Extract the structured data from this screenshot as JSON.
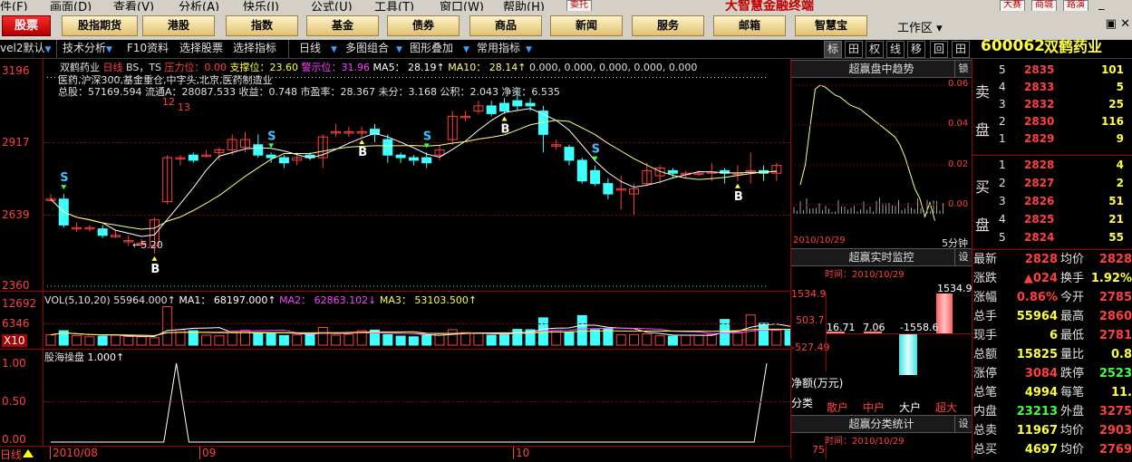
{
  "menu": {
    "items": [
      "件(F)",
      "画面(D)",
      "查看(V)",
      "分析(A)",
      "快乐(J)",
      "公式(U)",
      "工具(T)",
      "窗口(W)",
      "帮助(H)"
    ],
    "broker_btn": "委托",
    "brand": "大智慧金融终端",
    "right_btns": [
      "大赛",
      "商城",
      "路演"
    ]
  },
  "nav_buttons": [
    "股票",
    "股指期货",
    "港股",
    "指数",
    "基金",
    "债券",
    "商品",
    "新闻",
    "服务",
    "邮箱",
    "智慧宝"
  ],
  "workarea_label": "工作区",
  "toolbar": {
    "left_clip": "vel2默认",
    "items": [
      "技术分析",
      "F10资料",
      "选择股票",
      "选择指标",
      "日线",
      "多图组合",
      "图形叠加",
      "常用指标"
    ],
    "right_tabs": [
      "标",
      "田",
      "权",
      "线",
      "移",
      "回",
      "田"
    ]
  },
  "stock": {
    "code": "600062",
    "name": "双鹤药业"
  },
  "main_chart": {
    "legend_name": "双鹤药业",
    "legend_period": "日线",
    "legend_bs": "BS，TS",
    "pressure_label": "压力位：",
    "pressure_value": "0.00",
    "support_label": "支撑位：",
    "support_value": "23.60",
    "alert_label": "警示位：",
    "alert_value": "31.96",
    "ma5": "MA5： 28.19↑",
    "ma10": "MA10： 28.14↑",
    "extra": "0.000, 0.000, 0.000, 0.000, 0.000",
    "sectors": "医药,沪深300,基金重仓,中字头,北京,医药制造业",
    "info": "总股：57169.594 流通A：28087.533 收益：0.748 市盈率：28.367 未分：3.168 公积：2.043 净资：6.535",
    "y_ticks": [
      "3196",
      "2917",
      "2639",
      "2360"
    ],
    "annotation_low": "←5.20",
    "annotation_12": "12",
    "annotation_13": "13"
  },
  "chart_data": [
    {
      "type": "candlestick",
      "title": "双鹤药业 日线",
      "y_unit": "price x100",
      "ylim": [
        2360,
        3196
      ],
      "x_labels": [
        "2010/08",
        "09",
        "10"
      ],
      "candles": [
        {
          "o": 2700,
          "c": 2700,
          "h": 2720,
          "l": 2690
        },
        {
          "o": 2700,
          "c": 2600,
          "h": 2720,
          "l": 2590
        },
        {
          "o": 2590,
          "c": 2590,
          "h": 2610,
          "l": 2575
        },
        {
          "o": 2590,
          "c": 2590,
          "h": 2600,
          "l": 2575
        },
        {
          "o": 2585,
          "c": 2560,
          "h": 2600,
          "l": 2550
        },
        {
          "o": 2560,
          "c": 2560,
          "h": 2580,
          "l": 2550
        },
        {
          "o": 2540,
          "c": 2540,
          "h": 2560,
          "l": 2520
        },
        {
          "o": 2530,
          "c": 2530,
          "h": 2545,
          "l": 2515
        },
        {
          "o": 2520,
          "c": 2620,
          "h": 2630,
          "l": 2490
        },
        {
          "o": 2690,
          "c": 2860,
          "h": 2870,
          "l": 2680
        },
        {
          "o": 2860,
          "c": 2860,
          "h": 2870,
          "l": 2830
        },
        {
          "o": 2870,
          "c": 2850,
          "h": 2880,
          "l": 2840
        },
        {
          "o": 2870,
          "c": 2870,
          "h": 2890,
          "l": 2860
        },
        {
          "o": 2880,
          "c": 2890,
          "h": 2900,
          "l": 2850
        },
        {
          "o": 2890,
          "c": 2930,
          "h": 2950,
          "l": 2870
        },
        {
          "o": 2900,
          "c": 2930,
          "h": 2960,
          "l": 2880
        },
        {
          "o": 2910,
          "c": 2870,
          "h": 2950,
          "l": 2860
        },
        {
          "o": 2870,
          "c": 2860,
          "h": 2880,
          "l": 2840
        },
        {
          "o": 2860,
          "c": 2840,
          "h": 2870,
          "l": 2820
        },
        {
          "o": 2850,
          "c": 2860,
          "h": 2880,
          "l": 2830
        },
        {
          "o": 2870,
          "c": 2860,
          "h": 2880,
          "l": 2850
        },
        {
          "o": 2860,
          "c": 2940,
          "h": 2950,
          "l": 2820
        },
        {
          "o": 2960,
          "c": 2960,
          "h": 2990,
          "l": 2940
        },
        {
          "o": 2960,
          "c": 2960,
          "h": 2980,
          "l": 2940
        },
        {
          "o": 2960,
          "c": 2960,
          "h": 2980,
          "l": 2940
        },
        {
          "o": 2970,
          "c": 2950,
          "h": 2990,
          "l": 2920
        },
        {
          "o": 2930,
          "c": 2870,
          "h": 2950,
          "l": 2840
        },
        {
          "o": 2870,
          "c": 2860,
          "h": 2880,
          "l": 2840
        },
        {
          "o": 2860,
          "c": 2850,
          "h": 2870,
          "l": 2830
        },
        {
          "o": 2860,
          "c": 2840,
          "h": 2880,
          "l": 2820
        },
        {
          "o": 2870,
          "c": 2890,
          "h": 2910,
          "l": 2850
        },
        {
          "o": 2930,
          "c": 3020,
          "h": 3040,
          "l": 2910
        },
        {
          "o": 3020,
          "c": 3020,
          "h": 3040,
          "l": 3000
        },
        {
          "o": 3040,
          "c": 3060,
          "h": 3080,
          "l": 3030
        },
        {
          "o": 3060,
          "c": 3030,
          "h": 3080,
          "l": 3020
        },
        {
          "o": 3070,
          "c": 3040,
          "h": 3090,
          "l": 3030
        },
        {
          "o": 3080,
          "c": 3060,
          "h": 3120,
          "l": 3040
        },
        {
          "o": 3070,
          "c": 3060,
          "h": 3090,
          "l": 3040
        },
        {
          "o": 3040,
          "c": 2950,
          "h": 3060,
          "l": 2880
        },
        {
          "o": 2910,
          "c": 2910,
          "h": 2930,
          "l": 2890
        },
        {
          "o": 2900,
          "c": 2850,
          "h": 2910,
          "l": 2830
        },
        {
          "o": 2850,
          "c": 2770,
          "h": 2860,
          "l": 2760
        },
        {
          "o": 2810,
          "c": 2760,
          "h": 2830,
          "l": 2750
        },
        {
          "o": 2760,
          "c": 2720,
          "h": 2780,
          "l": 2700
        },
        {
          "o": 2740,
          "c": 2740,
          "h": 2790,
          "l": 2660
        },
        {
          "o": 2720,
          "c": 2740,
          "h": 2760,
          "l": 2640
        },
        {
          "o": 2760,
          "c": 2810,
          "h": 2840,
          "l": 2750
        },
        {
          "o": 2790,
          "c": 2820,
          "h": 2830,
          "l": 2760
        },
        {
          "o": 2810,
          "c": 2800,
          "h": 2820,
          "l": 2780
        },
        {
          "o": 2800,
          "c": 2800,
          "h": 2810,
          "l": 2780
        },
        {
          "o": 2800,
          "c": 2800,
          "h": 2810,
          "l": 2790
        },
        {
          "o": 2800,
          "c": 2805,
          "h": 2840,
          "l": 2770
        },
        {
          "o": 2810,
          "c": 2800,
          "h": 2820,
          "l": 2760
        },
        {
          "o": 2800,
          "c": 2800,
          "h": 2830,
          "l": 2770
        },
        {
          "o": 2810,
          "c": 2810,
          "h": 2880,
          "l": 2760
        },
        {
          "o": 2810,
          "c": 2800,
          "h": 2830,
          "l": 2770
        },
        {
          "o": 2800,
          "c": 2830,
          "h": 2840,
          "l": 2770
        }
      ],
      "signals": [
        {
          "i": 1,
          "type": "S"
        },
        {
          "i": 8,
          "type": "B"
        },
        {
          "i": 17,
          "type": "S"
        },
        {
          "i": 24,
          "type": "B"
        },
        {
          "i": 29,
          "type": "S"
        },
        {
          "i": 35,
          "type": "B"
        },
        {
          "i": 42,
          "type": "S"
        },
        {
          "i": 53,
          "type": "B"
        }
      ]
    },
    {
      "type": "bar",
      "title": "VOL(5,10,20)",
      "ylim": [
        0,
        12692
      ],
      "y_ticks": [
        "12692",
        "6346"
      ],
      "values": [
        3200,
        4500,
        3000,
        2600,
        2800,
        3100,
        2700,
        2600,
        2300,
        12000,
        4800,
        4500,
        3100,
        2900,
        4300,
        4600,
        3900,
        3600,
        3000,
        3200,
        3300,
        5500,
        3100,
        3400,
        4500,
        4700,
        3300,
        2800,
        2600,
        3000,
        3600,
        4800,
        3900,
        3700,
        3100,
        3700,
        4900,
        4800,
        8500,
        4600,
        4000,
        9200,
        4800,
        5200,
        3200,
        3300,
        3500,
        2900,
        2800,
        3100,
        3100,
        3300,
        8000,
        4100,
        9400,
        6800,
        4600,
        4600,
        5000
      ]
    },
    {
      "type": "line",
      "title": "股海操盘",
      "ylim": [
        0,
        1
      ],
      "y_ticks": [
        "1.00",
        "0.50",
        "0.00"
      ],
      "values": [
        0,
        0,
        0,
        0,
        0,
        0,
        0,
        0,
        0,
        0,
        1,
        0,
        0,
        0,
        0,
        0,
        0,
        0,
        0,
        0,
        0,
        0,
        0,
        0,
        0,
        0,
        0,
        0,
        0,
        0,
        0,
        0,
        0,
        0,
        0,
        0,
        0,
        0,
        0,
        0,
        0,
        0,
        0,
        0,
        0,
        0,
        0,
        0,
        0,
        0,
        0,
        0,
        0,
        0,
        0,
        0,
        0,
        1
      ]
    }
  ],
  "vol_legend": {
    "label": "VOL(5,10,20)",
    "vol": "55964.000↑",
    "ma1": "MA1： 68197.000↑",
    "ma2": "MA2： 62863.102↓",
    "ma3": "MA3： 53103.500↑",
    "ytick1": "12692",
    "ytick2": "6346",
    "unit": "X10"
  },
  "ind_legend": {
    "label": "股海操盘",
    "value": "1.000↑",
    "ticks": [
      "1.00",
      "0.50",
      "0.00"
    ]
  },
  "x_axis": {
    "period": "日线",
    "label1": "2010/08",
    "label2": "09",
    "label3": "10"
  },
  "trend_panel": {
    "title": "超赢盘中趋势",
    "side": "锁",
    "date": "2010/10/29",
    "period": "5分钟",
    "ticks": [
      "0.06",
      "0.04",
      "0.02",
      "0.00"
    ]
  },
  "monitor_panel": {
    "title": "超赢实时监控",
    "side": "设",
    "date": "时间：2010/10/29",
    "y1": "1534.9",
    "y2": "503.7",
    "y3": "-527.49",
    "v1": "16.71",
    "v2": "7.06",
    "v3": "-1558.6",
    "v4": "1534.9",
    "net_label": "净额(万元)",
    "cat_label": "分类",
    "cats": [
      "散户",
      "中户",
      "大户",
      "超大"
    ]
  },
  "stats_panel": {
    "title": "超赢分类统计",
    "side": "设",
    "date": "时间：2010/10/29",
    "y1": "75"
  },
  "orderbook": {
    "sell_label": [
      "卖",
      "盘"
    ],
    "buy_label": [
      "买",
      "盘"
    ],
    "sells": [
      {
        "lvl": "5",
        "price": "2835",
        "vol": "101"
      },
      {
        "lvl": "4",
        "price": "2833",
        "vol": "5"
      },
      {
        "lvl": "3",
        "price": "2832",
        "vol": "25"
      },
      {
        "lvl": "2",
        "price": "2830",
        "vol": "116"
      },
      {
        "lvl": "1",
        "price": "2829",
        "vol": "9"
      }
    ],
    "buys": [
      {
        "lvl": "1",
        "price": "2828",
        "vol": "4"
      },
      {
        "lvl": "2",
        "price": "2827",
        "vol": "2"
      },
      {
        "lvl": "3",
        "price": "2826",
        "vol": "51"
      },
      {
        "lvl": "4",
        "price": "2825",
        "vol": "21"
      },
      {
        "lvl": "5",
        "price": "2824",
        "vol": "55"
      }
    ]
  },
  "stats": [
    {
      "l1": "最新",
      "v1": "2828",
      "l2": "均价",
      "v2": "2828",
      "c1": "#ff4040",
      "c2": "#ff4040"
    },
    {
      "l1": "涨跌",
      "v1": "▲024",
      "l2": "换手",
      "v2": "1.92%",
      "c1": "#ff4040",
      "c2": "#ffff40"
    },
    {
      "l1": "涨幅",
      "v1": "0.86%",
      "l2": "今开",
      "v2": "2785",
      "c1": "#ff4040",
      "c2": "#ff4040"
    },
    {
      "l1": "总手",
      "v1": "55964",
      "l2": "最高",
      "v2": "2860",
      "c1": "#ffff40",
      "c2": "#ff4040"
    },
    {
      "l1": "现手",
      "v1": "6",
      "l2": "最低",
      "v2": "2781",
      "c1": "#ffff40",
      "c2": "#ff4040"
    },
    {
      "l1": "总额",
      "v1": "15825",
      "l2": "量比",
      "v2": "0.8",
      "c1": "#ffff40",
      "c2": "#ffff40"
    },
    {
      "l1": "涨停",
      "v1": "3084",
      "l2": "跌停",
      "v2": "2523",
      "c1": "#ff4040",
      "c2": "#40ff40"
    },
    {
      "l1": "总笔",
      "v1": "4994",
      "l2": "每笔",
      "v2": "11.",
      "c1": "#ffff40",
      "c2": "#ffff40"
    },
    {
      "l1": "内盘",
      "v1": "23213",
      "l2": "外盘",
      "v2": "3275",
      "c1": "#40ff40",
      "c2": "#ff4040"
    },
    {
      "l1": "总卖",
      "v1": "11967",
      "l2": "均价",
      "v2": "2903",
      "c1": "#ffff40",
      "c2": "#ff4040"
    },
    {
      "l1": "总买",
      "v1": "4697",
      "l2": "均价",
      "v2": "2769",
      "c1": "#ffff40",
      "c2": "#ff4040"
    }
  ],
  "colors": {
    "up": "#ff4040",
    "down": "#40ffff",
    "ma5": "#ffffff",
    "ma10": "#ffff80",
    "bg": "#000000"
  }
}
